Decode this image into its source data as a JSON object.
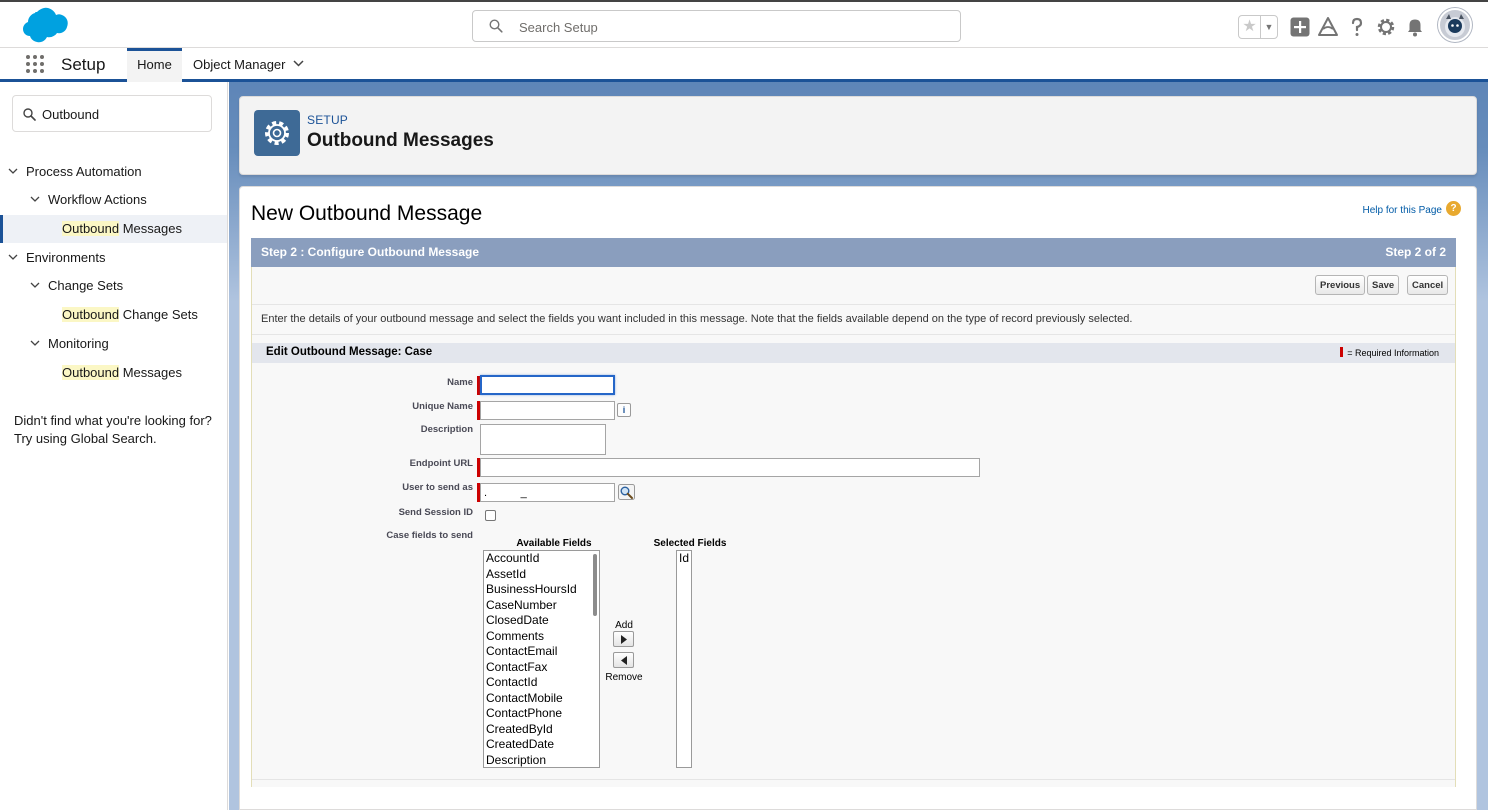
{
  "header": {
    "search_placeholder": "Search Setup",
    "icons": [
      "salesforce-cloud-logo",
      "star-icon",
      "dropdown-icon",
      "plus-icon",
      "trailhead-icon",
      "help-icon",
      "gear-icon",
      "bell-icon",
      "user-avatar"
    ]
  },
  "nav": {
    "app_name": "Setup",
    "tabs": [
      {
        "label": "Home",
        "active": true
      },
      {
        "label": "Object Manager",
        "active": false
      }
    ]
  },
  "sidebar": {
    "quickfind_value": "Outbound",
    "tree": {
      "process_automation": "Process Automation",
      "workflow_actions": "Workflow Actions",
      "wa_outbound_hl": "Outbound",
      "wa_outbound_rest": " Messages",
      "environments": "Environments",
      "change_sets": "Change Sets",
      "cs_outbound_hl": "Outbound",
      "cs_outbound_rest": " Change Sets",
      "monitoring": "Monitoring",
      "mon_outbound_hl": "Outbound",
      "mon_outbound_rest": " Messages"
    },
    "not_found_line1": "Didn't find what you're looking for?",
    "not_found_line2": "Try using Global Search."
  },
  "page_header": {
    "subtitle": "SETUP",
    "title": "Outbound Messages"
  },
  "content": {
    "heading": "New Outbound Message",
    "help_link": "Help for this Page",
    "help_icon_glyph": "?",
    "step_title": "Step 2 : Configure Outbound Message",
    "step_count": "Step 2 of 2",
    "buttons": {
      "previous": "Previous",
      "save": "Save",
      "cancel": "Cancel"
    },
    "intro": "Enter the details of your outbound message and select the fields you want included in this message. Note that the fields available depend on the type of record previously selected.",
    "section_title": "Edit Outbound Message: Case",
    "required_info": "= Required Information",
    "fields": {
      "name_label": "Name",
      "name_value": "",
      "unique_name_label": "Unique Name",
      "unique_name_value": "",
      "info_glyph": "i",
      "description_label": "Description",
      "endpoint_label": "Endpoint URL",
      "endpoint_value": "",
      "user_label": "User to send as",
      "user_value": ".           _",
      "session_label": "Send Session ID",
      "session_checked": false,
      "case_fields_label": "Case fields to send"
    },
    "picklist": {
      "available_header": "Available Fields",
      "selected_header": "Selected Fields",
      "add_label": "Add",
      "remove_label": "Remove",
      "available": [
        "AccountId",
        "AssetId",
        "BusinessHoursId",
        "CaseNumber",
        "ClosedDate",
        "Comments",
        "ContactEmail",
        "ContactFax",
        "ContactId",
        "ContactMobile",
        "ContactPhone",
        "CreatedById",
        "CreatedDate",
        "Description"
      ],
      "selected": [
        "Id"
      ]
    }
  },
  "colors": {
    "brand_blue": "#1b5297",
    "step_bar": "#8a9ebe",
    "required_red": "#cc0000",
    "highlight": "#fbf7c5"
  }
}
